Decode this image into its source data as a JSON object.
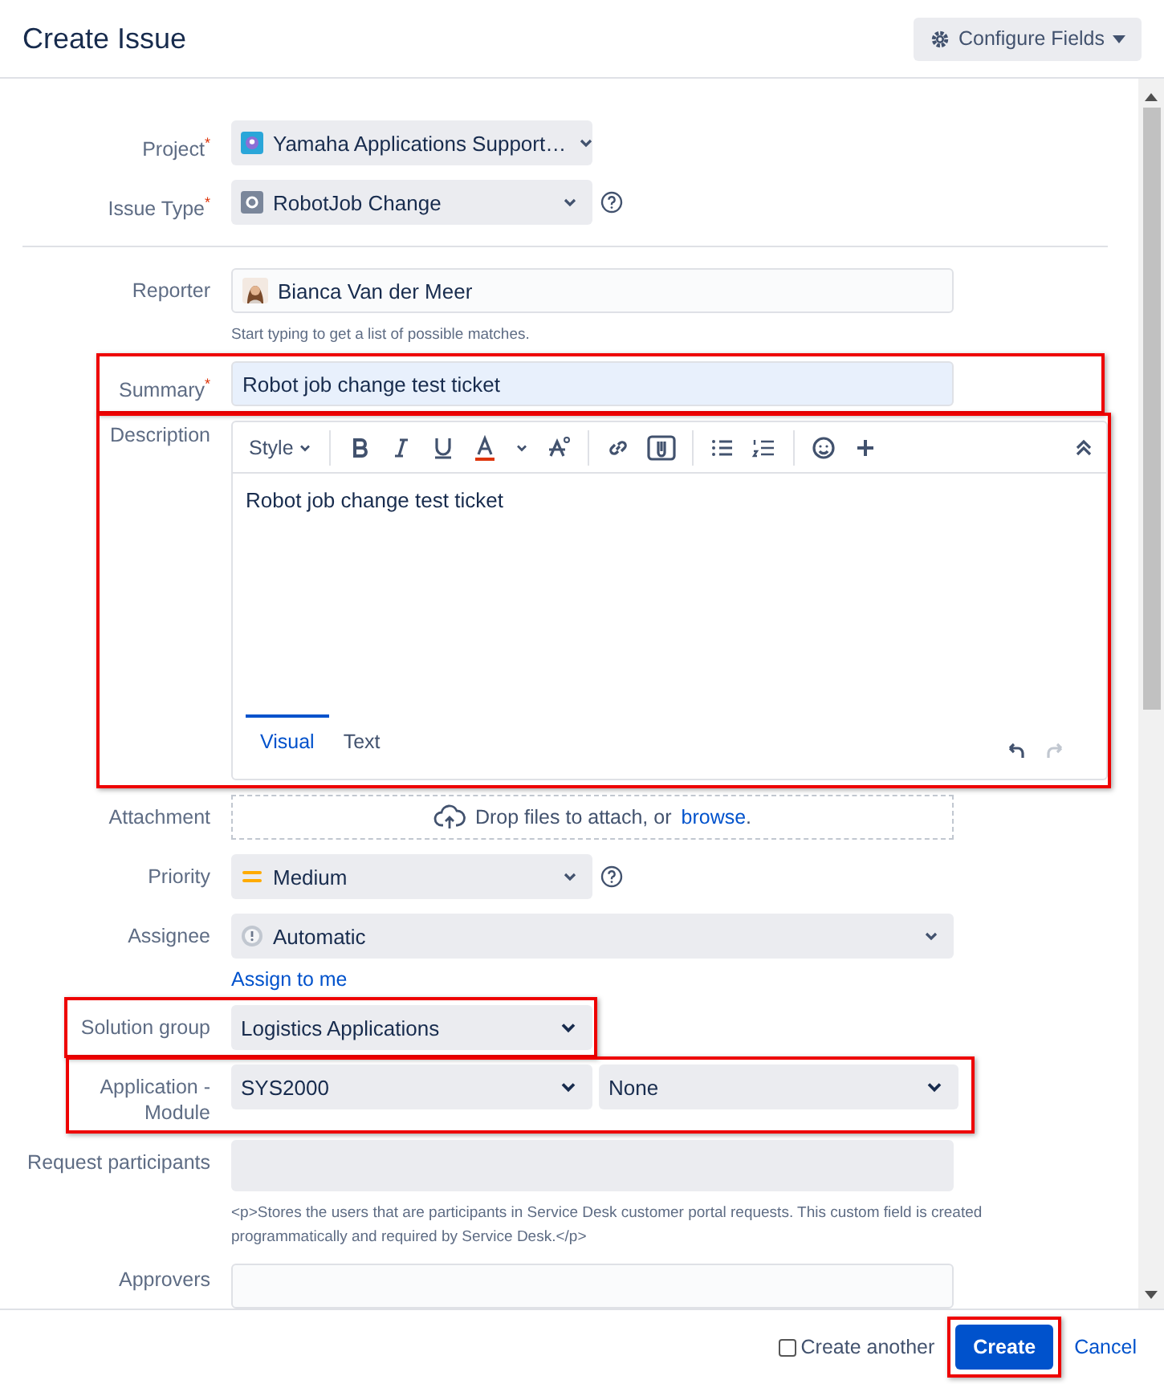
{
  "dialog": {
    "title": "Create Issue",
    "configure_button": "Configure Fields"
  },
  "fields": [
    {
      "kind": "project",
      "label": "Project",
      "required_mark": "*",
      "value": "Yamaha Applications Support…"
    },
    {
      "kind": "issue_type",
      "label": "Issue Type",
      "required_mark": "*",
      "value": "RobotJob Change",
      "help": true
    },
    {
      "kind": "divider"
    },
    {
      "kind": "user",
      "label": "Reporter",
      "value": "Bianca Van der Meer",
      "hint": "Start typing to get a list of possible matches."
    },
    {
      "kind": "text",
      "label": "Summary",
      "required_mark": "*",
      "value": "Robot job change test ticket",
      "highlighted": true
    },
    {
      "kind": "editor",
      "label": "Description",
      "style_label": "Style",
      "value": "Robot job change test ticket",
      "tabs": [
        {
          "label": "Visual",
          "selected": true
        },
        {
          "label": "Text",
          "selected": false
        }
      ],
      "highlighted": true
    },
    {
      "kind": "attachment",
      "label": "Attachment",
      "text": "Drop files to attach, or",
      "link": "browse",
      "end": "."
    },
    {
      "kind": "priority",
      "label": "Priority",
      "value": "Medium",
      "help": true
    },
    {
      "kind": "assignee",
      "label": "Assignee",
      "value": "Automatic",
      "link": "Assign to me"
    },
    {
      "kind": "select",
      "label": "Solution group",
      "value": "Logistics Applications",
      "highlighted": true
    },
    {
      "kind": "cascade",
      "label": "Application - Module",
      "value": "SYS2000",
      "second_value": "None",
      "highlighted": true
    },
    {
      "kind": "participants",
      "label": "Request participants",
      "hint": "<p>Stores the users that are participants in Service Desk customer portal requests. This custom field is created programmatically and required by Service Desk.</p>"
    },
    {
      "kind": "approvers",
      "label": "Approvers"
    }
  ],
  "footer": {
    "create_another": {
      "label": "Create another",
      "checked": false
    },
    "create_button": {
      "label": "Create",
      "highlighted": true
    },
    "cancel_link": "Cancel"
  }
}
